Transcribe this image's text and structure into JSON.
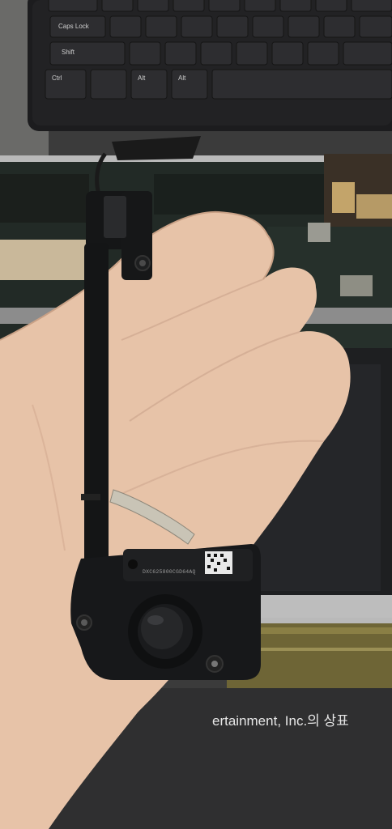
{
  "photo": {
    "subject": "laptop speaker module held in hand",
    "keyboard_keys": [
      "Caps Lock",
      "Shift",
      "Ctrl",
      "Alt",
      "Alt"
    ],
    "part_number": "DXC625800CGD64AQ",
    "background_text": "ertainment, Inc.의 상표 "
  }
}
